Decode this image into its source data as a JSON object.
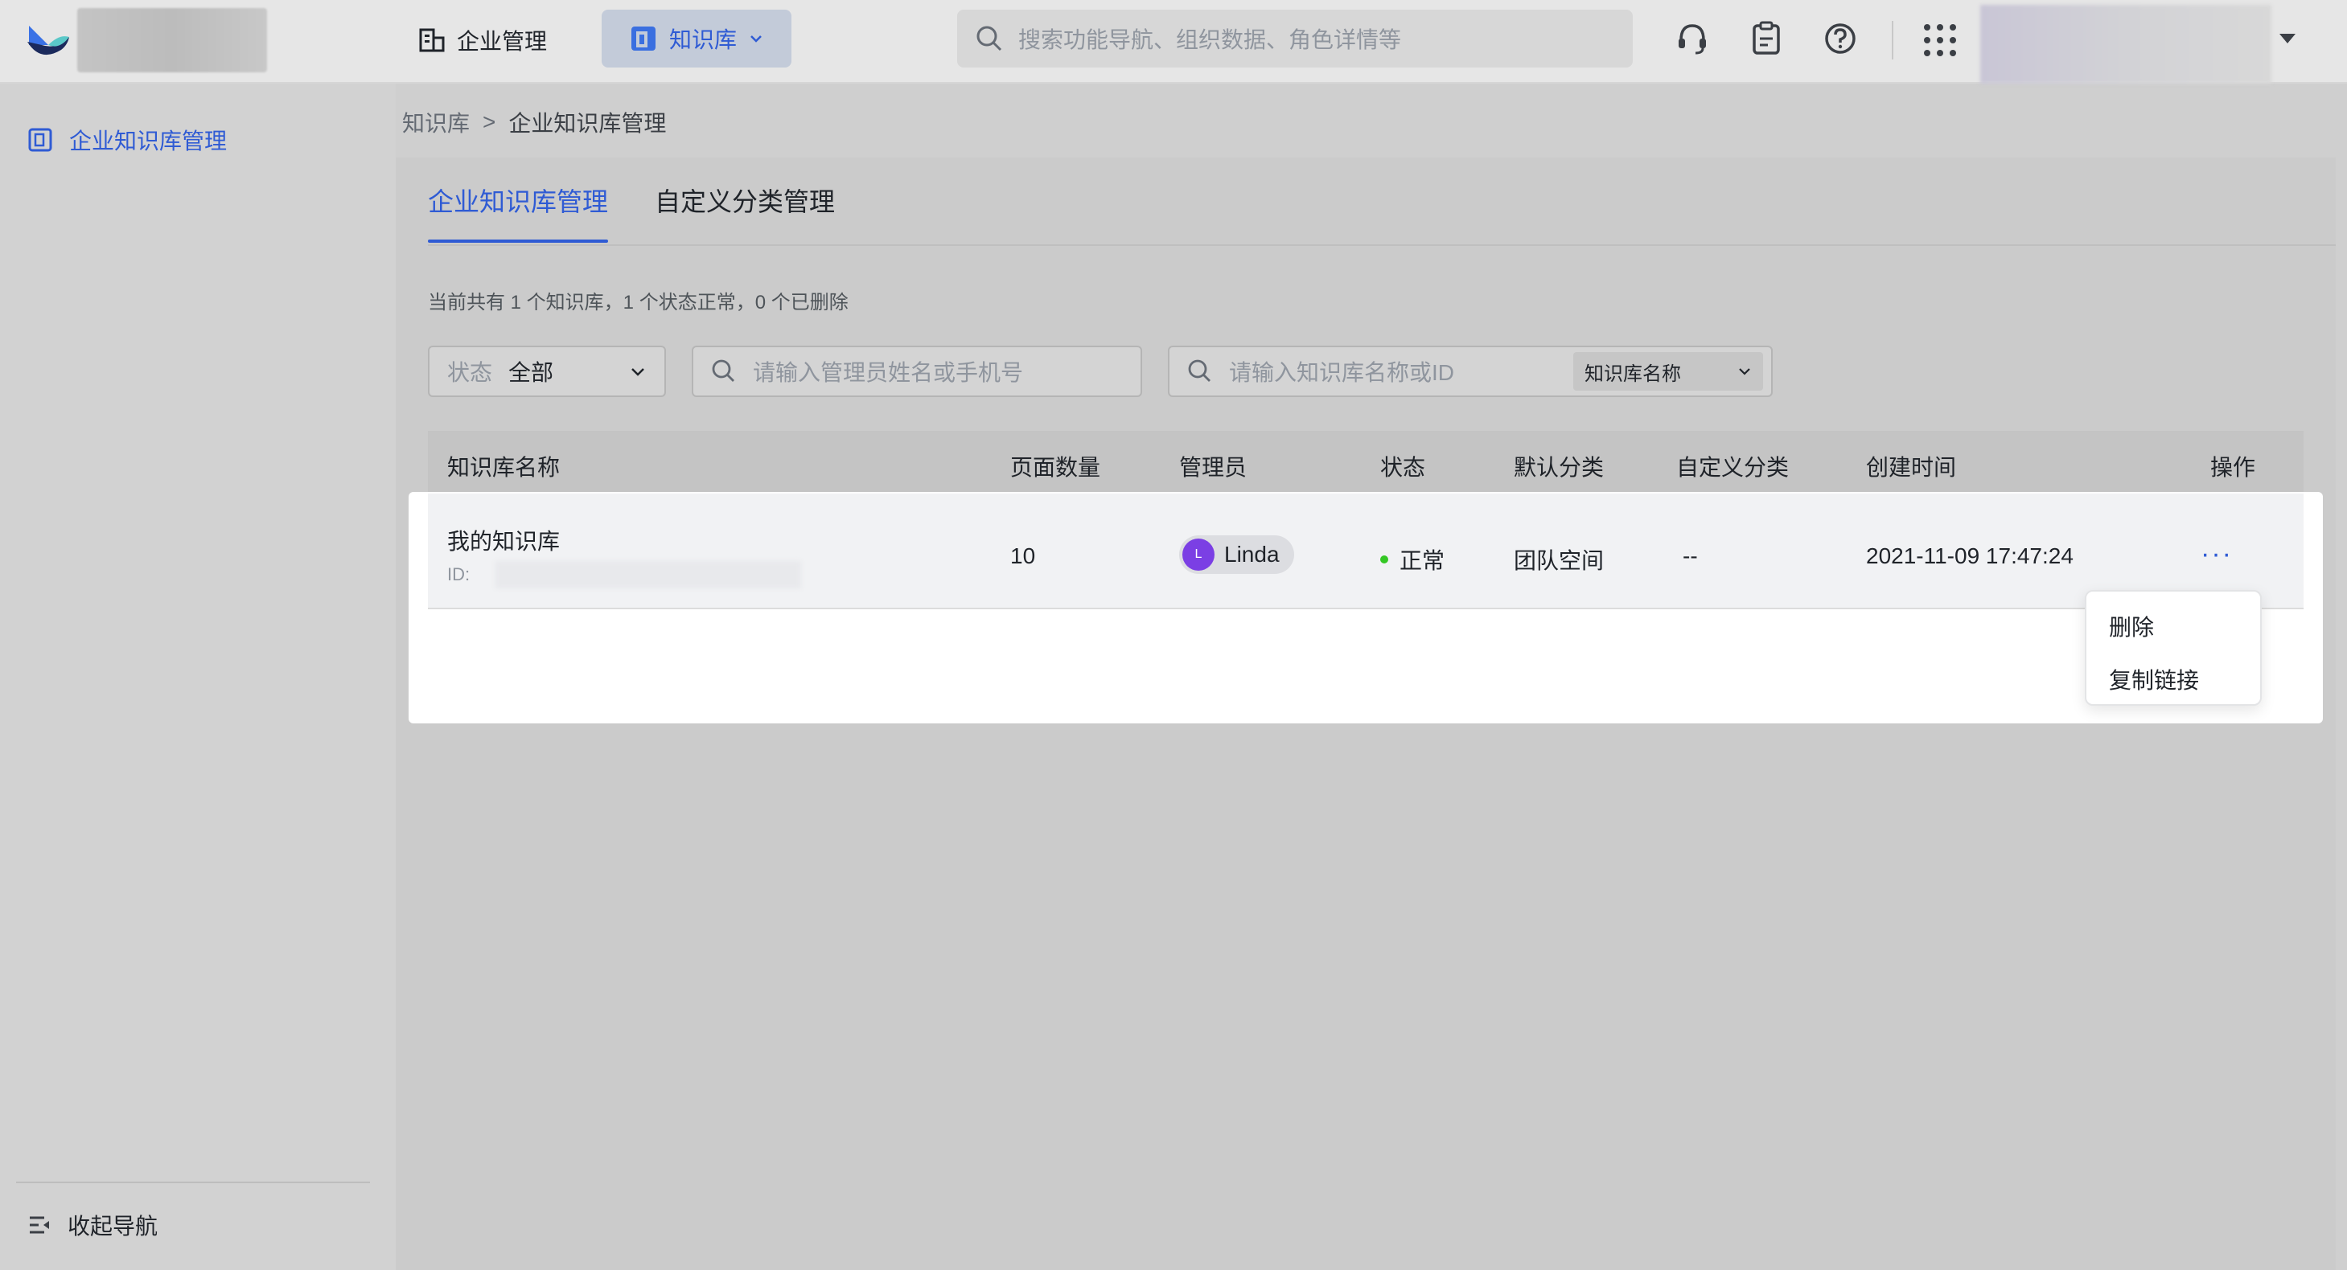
{
  "topbar": {
    "nav_enterprise": "企业管理",
    "nav_knowledge": "知识库",
    "search_placeholder": "搜索功能导航、组织数据、角色详情等"
  },
  "sidebar": {
    "item_label": "企业知识库管理",
    "collapse_label": "收起导航"
  },
  "breadcrumb": {
    "root": "知识库",
    "separator": ">",
    "current": "企业知识库管理"
  },
  "tabs": [
    {
      "label": "企业知识库管理",
      "active": true
    },
    {
      "label": "自定义分类管理",
      "active": false
    }
  ],
  "summary": "当前共有 1 个知识库，1 个状态正常，0 个已删除",
  "filters": {
    "status_label": "状态",
    "status_value": "全部",
    "admin_placeholder": "请输入管理员姓名或手机号",
    "kb_placeholder": "请输入知识库名称或ID",
    "kb_field": "知识库名称"
  },
  "table": {
    "headers": [
      "知识库名称",
      "页面数量",
      "管理员",
      "状态",
      "默认分类",
      "自定义分类",
      "创建时间",
      "操作"
    ],
    "rows": [
      {
        "name": "我的知识库",
        "id_label": "ID:",
        "pages": "10",
        "admin_initial": "L",
        "admin_name": "Linda",
        "status": "正常",
        "default_category": "团队空间",
        "custom_category": "--",
        "created": "2021-11-09 17:47:24",
        "action": "···"
      }
    ]
  },
  "row_menu": [
    "删除",
    "复制链接"
  ],
  "colors": {
    "accent": "#2f5bd4",
    "status_ok": "#34c724",
    "avatar": "#7b3fe4"
  }
}
